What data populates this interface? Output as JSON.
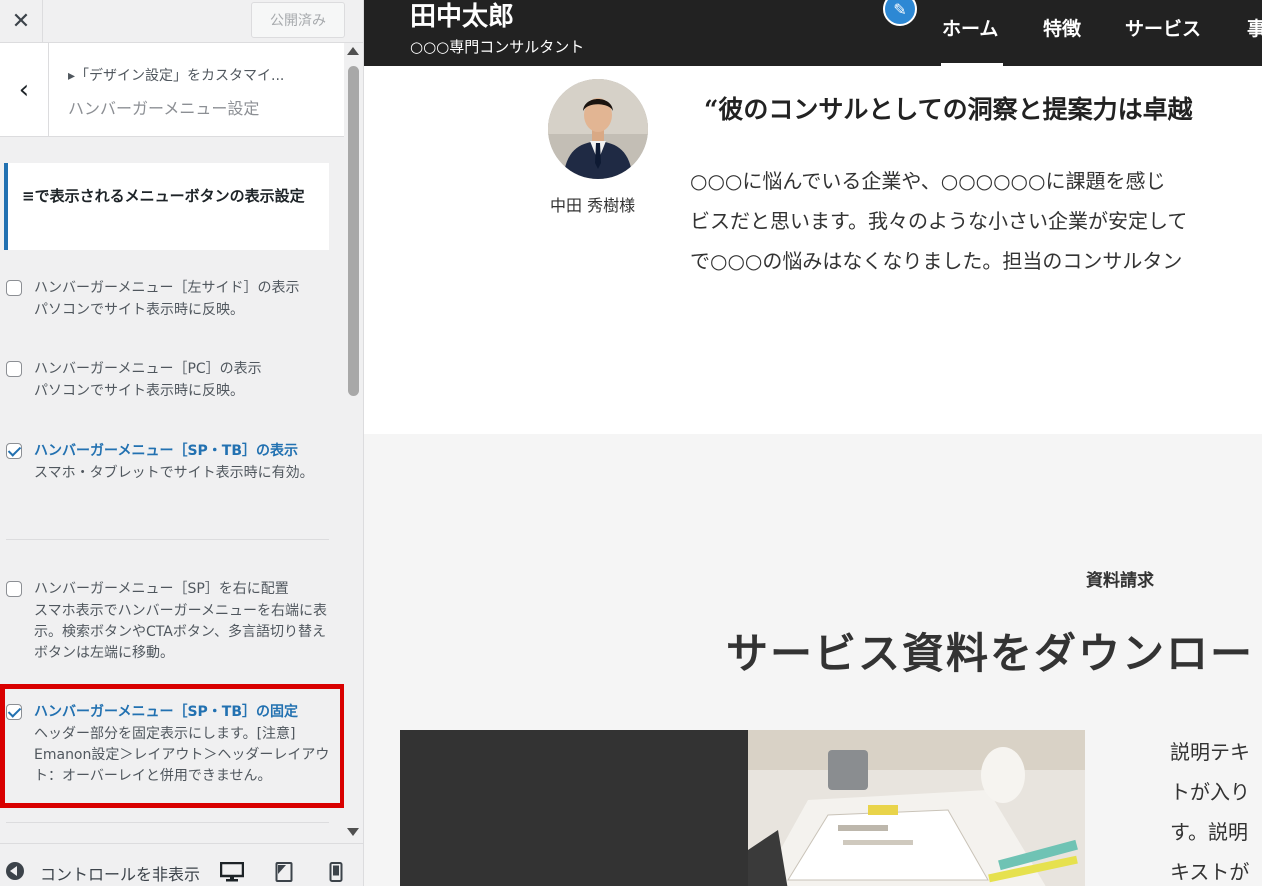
{
  "customizer": {
    "close_icon": "close-x-icon",
    "publish_label": "公開済み",
    "breadcrumb": "▸「デザイン設定」をカスタマイ...",
    "panel_title": "ハンバーガーメニュー設定",
    "section_heading": "≡で表示されるメニューボタンの表示設定",
    "options": [
      {
        "label": "ハンバーガーメニュー［左サイド］の表示",
        "desc": "パソコンでサイト表示時に反映。",
        "checked": false
      },
      {
        "label": "ハンバーガーメニュー［PC］の表示",
        "desc": "パソコンでサイト表示時に反映。",
        "checked": false
      },
      {
        "label": "ハンバーガーメニュー［SP・TB］の表示",
        "desc": "スマホ・タブレットでサイト表示時に有効。",
        "checked": true
      },
      {
        "label": "ハンバーガーメニュー［SP］を右に配置",
        "desc": "スマホ表示でハンバーガーメニューを右端に表示。検索ボタンやCTAボタン、多言語切り替えボタンは左端に移動。",
        "checked": false
      },
      {
        "label": "ハンバーガーメニュー［SP・TB］の固定",
        "desc": "ヘッダー部分を固定表示にします。[注意] Emanon設定＞レイアウト＞ヘッダーレイアウト：オーバーレイと併用できません。",
        "checked": true
      }
    ],
    "footer": {
      "collapse_label": "コントロールを非表示",
      "devices": [
        "desktop-icon",
        "tablet-icon",
        "mobile-icon"
      ]
    },
    "accent_color": "#2271b1",
    "highlight_color": "#d90000"
  },
  "preview": {
    "site_name": "田中太郎",
    "tagline": "○○○専門コンサルタント",
    "nav": [
      "ホーム",
      "特徴",
      "サービス",
      "事"
    ],
    "testimonial": {
      "person": "中田 秀樹様",
      "quote_title": "“彼のコンサルとしての洞察と提案力は卓越",
      "body_lines": [
        "○○○に悩んでいる企業や、○○○○○○に課題を感じ",
        "ビスだと思います。我々のような小さい企業が安定して",
        "で○○○の悩みはなくなりました。担当のコンサルタン"
      ]
    },
    "download": {
      "eyebrow": "資料請求",
      "heading": "サービス資料をダウンロー",
      "text_lines": [
        "説明テキ",
        "トが入り",
        "す。説明",
        "キストが"
      ]
    },
    "header_color": "#222222"
  }
}
